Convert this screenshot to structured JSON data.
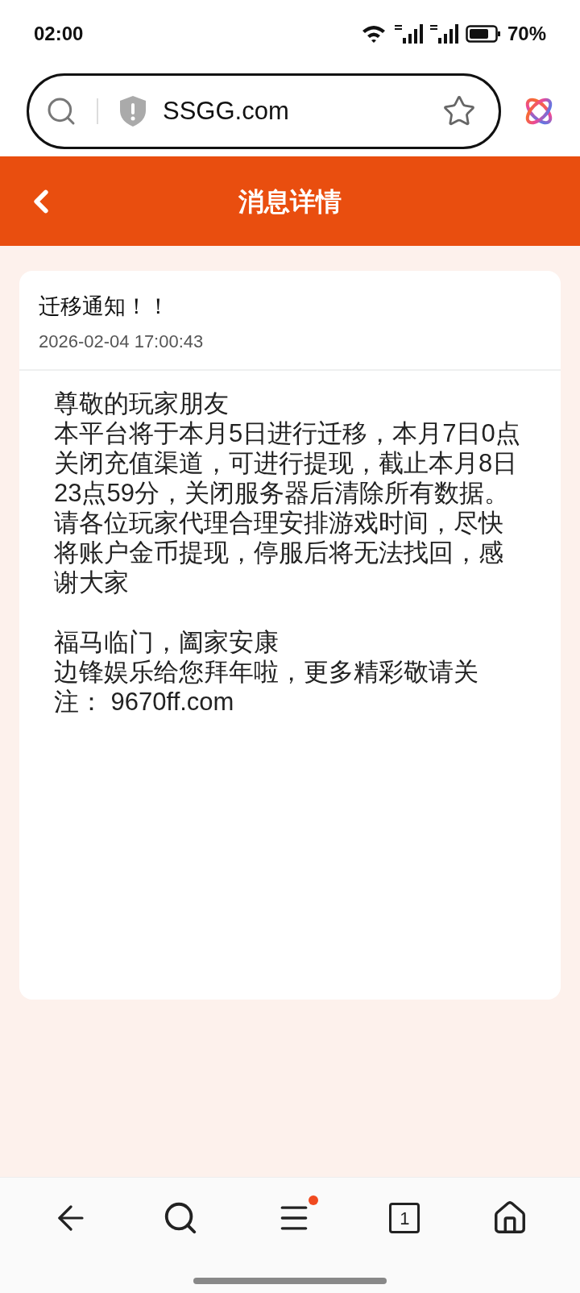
{
  "status_bar": {
    "time": "02:00",
    "battery": "70%"
  },
  "address_bar": {
    "url": "SSGG.com"
  },
  "header": {
    "title": "消息详情"
  },
  "message": {
    "title": "迁移通知！！",
    "time": "2026-02-04 17:00:43",
    "paragraphs": [
      [
        "尊敬的玩家朋友",
        "本平台将于本月5日进行迁移，本月7日0点",
        "关闭充值渠道，可进行提现，截止本月8日",
        "23点59分，关闭服务器后清除所有数据。",
        "请各位玩家代理合理安排游戏时间，尽快",
        "将账户金币提现，停服后将无法找回，感",
        "谢大家"
      ],
      [
        "福马临门，阖家安康",
        "边锋娱乐给您拜年啦，更多精彩敬请关",
        "注： 9670ff.com"
      ]
    ]
  },
  "bottom_nav": {
    "tab_count": "1",
    "menu_badge": true
  }
}
